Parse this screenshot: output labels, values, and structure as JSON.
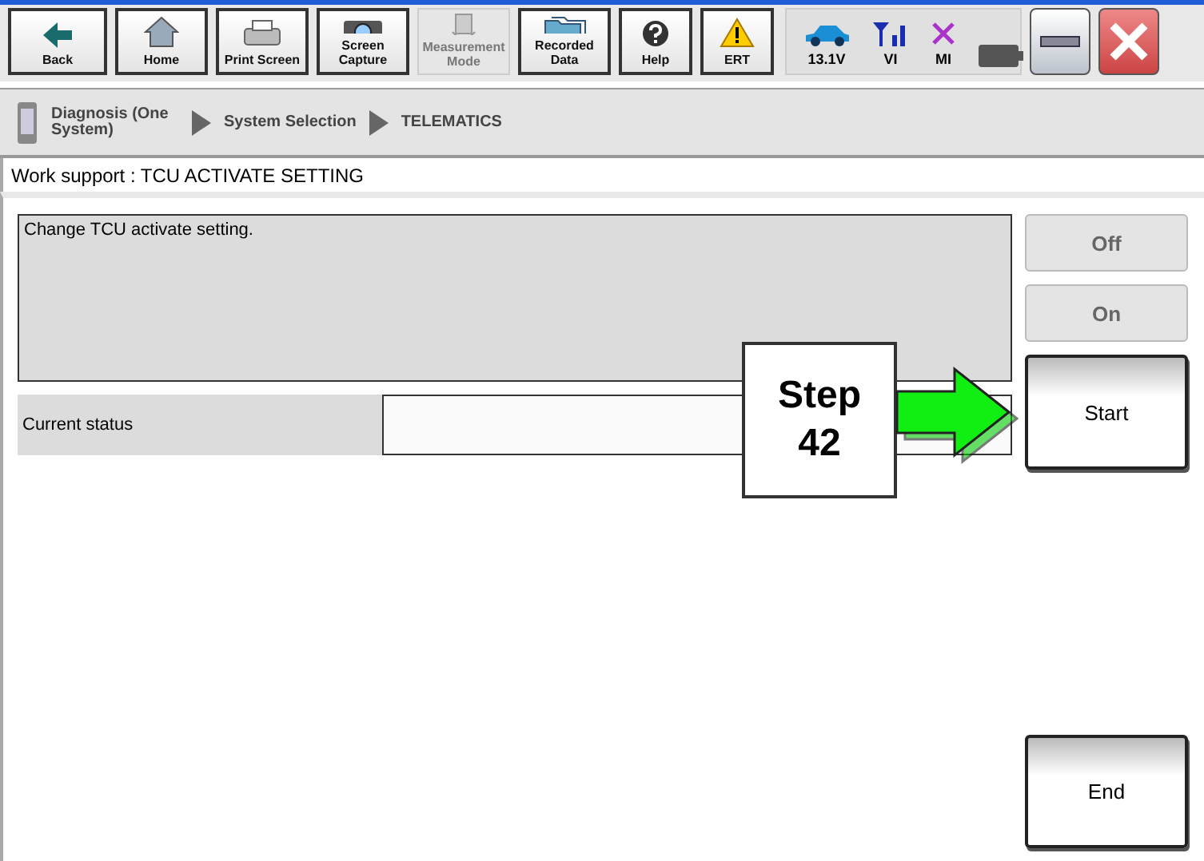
{
  "toolbar": [
    {
      "label": "Back",
      "kind": "back",
      "disabled": false
    },
    {
      "label": "Home",
      "kind": "home",
      "disabled": false
    },
    {
      "label": "Print Screen",
      "kind": "print",
      "disabled": false
    },
    {
      "label": "Screen Capture",
      "kind": "camera",
      "disabled": false
    },
    {
      "label": "Measurement Mode",
      "kind": "measure",
      "disabled": true
    },
    {
      "label": "Recorded Data",
      "kind": "folders",
      "disabled": false
    },
    {
      "label": "Help",
      "kind": "help",
      "disabled": false
    },
    {
      "label": "ERT",
      "kind": "warning",
      "disabled": false
    }
  ],
  "status_icons": [
    {
      "label": "13.1V",
      "kind": "car"
    },
    {
      "label": "VI",
      "kind": "signal"
    },
    {
      "label": "MI",
      "kind": "cross"
    },
    {
      "kind": "battery"
    }
  ],
  "breadcrumb": [
    "Diagnosis (One System)",
    "System Selection",
    "TELEMATICS"
  ],
  "header": "Work support : TCU ACTIVATE SETTING",
  "description": "Change TCU activate setting.",
  "status": {
    "label": "Current status"
  },
  "side_buttons": [
    {
      "label": "Off",
      "disabled": true
    },
    {
      "label": "On",
      "disabled": true
    },
    {
      "label": "Start",
      "disabled": false
    }
  ],
  "end_button": {
    "label": "End",
    "disabled": false
  },
  "callout": {
    "text": "Step 42"
  }
}
